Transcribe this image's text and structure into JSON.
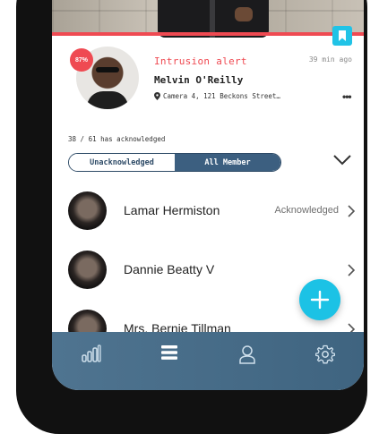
{
  "alert": {
    "confidence": "87%",
    "type": "Intrusion alert",
    "time": "39 min ago",
    "person_name": "Melvin O'Reilly",
    "location": "Camera 4, 121 Beckons Street…",
    "more_label": "•••"
  },
  "acknowledged_summary": "38 / 61 has acknowledged",
  "filter": {
    "options": [
      "Unacknowledged",
      "All Member"
    ],
    "selected": "All Member"
  },
  "members": [
    {
      "name": "Lamar Hermiston",
      "status": "Acknowledged"
    },
    {
      "name": "Dannie Beatty V",
      "status": ""
    },
    {
      "name": "Mrs. Bernie Tillman",
      "status": ""
    }
  ],
  "icons": {
    "bookmark": "bookmark-icon",
    "location": "location-pin-icon",
    "fab": "plus-icon",
    "tabs": [
      "bar-chart-icon",
      "list-icon",
      "person-icon",
      "gear-icon"
    ]
  },
  "colors": {
    "alert_red": "#ef4a52",
    "accent_cyan": "#1cc2e5",
    "nav_blue": "#3c5f80"
  },
  "nav": {
    "active_tab": "list-icon"
  }
}
